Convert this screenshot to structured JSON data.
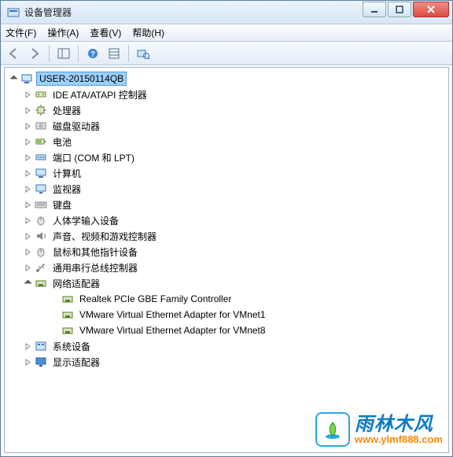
{
  "window": {
    "title": "设备管理器"
  },
  "menus": {
    "file": "文件(F)",
    "action": "操作(A)",
    "view": "查看(V)",
    "help": "帮助(H)"
  },
  "toolbar_icons": [
    "back",
    "forward",
    "up",
    "detail",
    "help-icon",
    "view-icon",
    "scan-icon"
  ],
  "root": {
    "label": "USER-20150114QB"
  },
  "nodes": [
    {
      "id": "ide",
      "label": "IDE ATA/ATAPI 控制器",
      "expandable": true,
      "icon": "ide"
    },
    {
      "id": "cpu",
      "label": "处理器",
      "expandable": true,
      "icon": "cpu"
    },
    {
      "id": "disk",
      "label": "磁盘驱动器",
      "expandable": true,
      "icon": "disk"
    },
    {
      "id": "battery",
      "label": "电池",
      "expandable": true,
      "icon": "battery"
    },
    {
      "id": "ports",
      "label": "端口 (COM 和 LPT)",
      "expandable": true,
      "icon": "port"
    },
    {
      "id": "computer",
      "label": "计算机",
      "expandable": true,
      "icon": "computer"
    },
    {
      "id": "monitor",
      "label": "监视器",
      "expandable": true,
      "icon": "monitor"
    },
    {
      "id": "keyboard",
      "label": "键盘",
      "expandable": true,
      "icon": "keyboard"
    },
    {
      "id": "hid",
      "label": "人体学输入设备",
      "expandable": true,
      "icon": "hid"
    },
    {
      "id": "sound",
      "label": "声音、视频和游戏控制器",
      "expandable": true,
      "icon": "sound"
    },
    {
      "id": "mouse",
      "label": "鼠标和其他指针设备",
      "expandable": true,
      "icon": "mouse"
    },
    {
      "id": "usb",
      "label": "通用串行总线控制器",
      "expandable": true,
      "icon": "usb"
    },
    {
      "id": "network",
      "label": "网络适配器",
      "expandable": true,
      "icon": "net",
      "expanded": true,
      "children": [
        {
          "id": "nic0",
          "label": "Realtek PCIe GBE Family Controller"
        },
        {
          "id": "nic1",
          "label": "VMware Virtual Ethernet Adapter for VMnet1"
        },
        {
          "id": "nic2",
          "label": "VMware Virtual Ethernet Adapter for VMnet8"
        }
      ]
    },
    {
      "id": "system",
      "label": "系统设备",
      "expandable": true,
      "icon": "sys"
    },
    {
      "id": "display",
      "label": "显示适配器",
      "expandable": true,
      "icon": "display"
    }
  ],
  "watermark": {
    "cn": "雨林木风",
    "url": "www.ylmf888.com"
  }
}
